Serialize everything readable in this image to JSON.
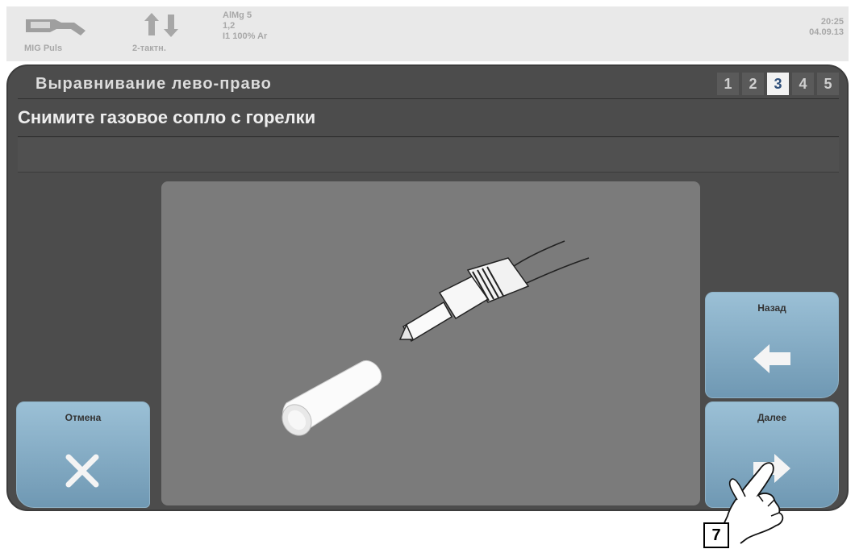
{
  "status": {
    "process_label": "MIG Puls",
    "mode_label": "2-тактн.",
    "params": [
      "AlMg 5",
      "1,2",
      "I1 100% Ar"
    ],
    "time": "20:25",
    "date": "04.09.13",
    "icons": [
      "torch-icon",
      "up-down-arrows-icon"
    ]
  },
  "header": {
    "title": "Выравнивание лево-право",
    "steps": [
      "1",
      "2",
      "3",
      "4",
      "5"
    ],
    "active_step": "3"
  },
  "instruction": "Снимите газовое сопло с горелки",
  "buttons": {
    "cancel_label": "Отмена",
    "back_label": "Назад",
    "next_label": "Далее"
  },
  "callout": "7",
  "colors": {
    "panel": "#4c4c4c",
    "softkey": "#8eb6cf",
    "active_step_text": "#2e4f7a",
    "image_bg": "#7b7b7b"
  }
}
